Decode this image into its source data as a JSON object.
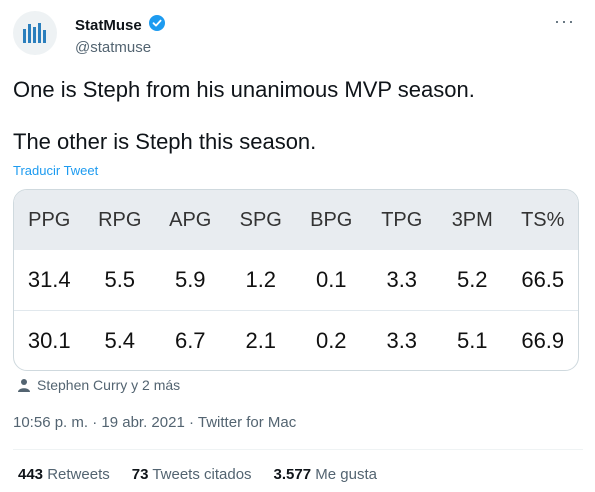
{
  "author": {
    "display_name": "StatMuse",
    "handle": "@statmuse"
  },
  "more_icon": "···",
  "tweet": {
    "line1": "One is Steph from his unanimous MVP season.",
    "line2": "The other is Steph this season.",
    "translate_label": "Traducir Tweet"
  },
  "stats_table": {
    "headers": [
      "PPG",
      "RPG",
      "APG",
      "SPG",
      "BPG",
      "TPG",
      "3PM",
      "TS%"
    ],
    "rows": [
      [
        "31.4",
        "5.5",
        "5.9",
        "1.2",
        "0.1",
        "3.3",
        "5.2",
        "66.5"
      ],
      [
        "30.1",
        "5.4",
        "6.7",
        "2.1",
        "0.2",
        "3.3",
        "5.1",
        "66.9"
      ]
    ]
  },
  "tagged": "Stephen Curry y 2 más",
  "meta": {
    "time": "10:56 p. m.",
    "sep": "·",
    "date": "19 abr. 2021",
    "source": "Twitter for Mac"
  },
  "engagement": {
    "retweets_count": "443",
    "retweets_label": "Retweets",
    "quotes_count": "73",
    "quotes_label": "Tweets citados",
    "likes_count": "3.577",
    "likes_label": "Me gusta"
  },
  "colors": {
    "accent": "#1d9bf0",
    "avatar_bar": "#2b7fbd",
    "table_header_bg": "#e8ecf0"
  },
  "icons": {
    "avatar": "statmuse-logo",
    "verified": "verified-badge-icon",
    "tagged": "person-icon"
  }
}
